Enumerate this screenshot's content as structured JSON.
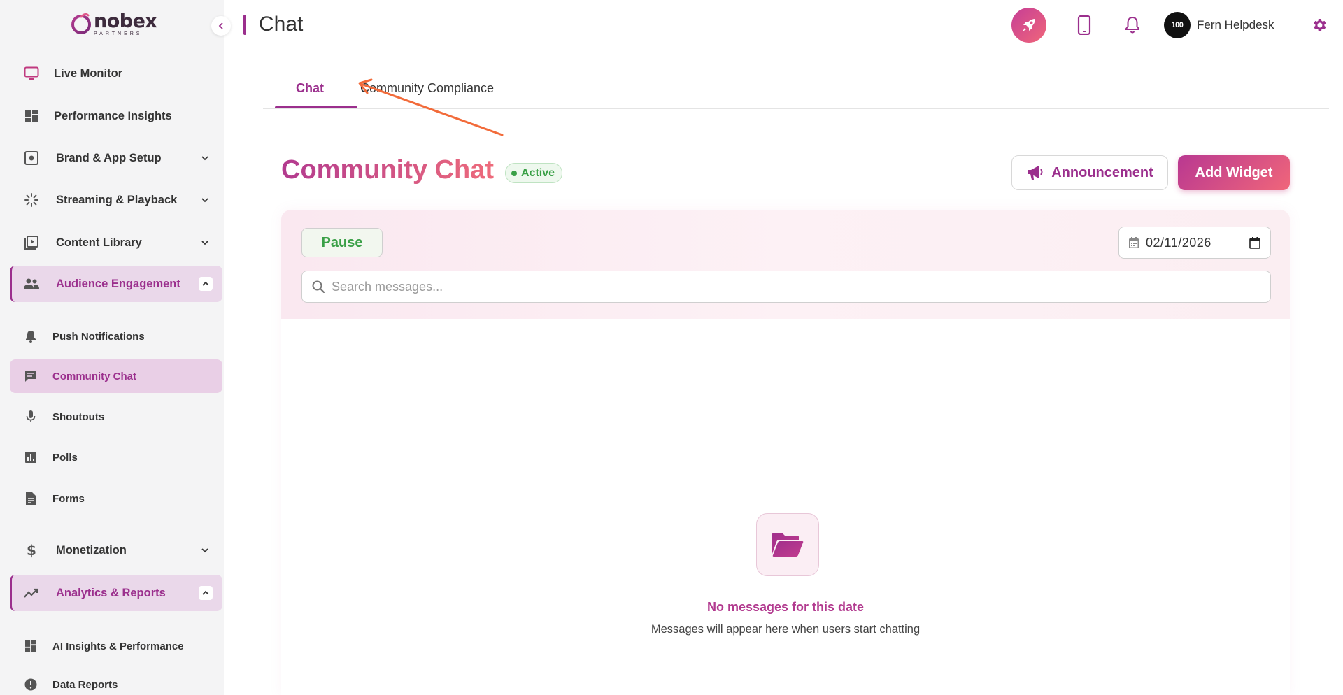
{
  "brand": {
    "name": "nobex",
    "sub": "PARTNERS"
  },
  "sidebar": {
    "items": [
      {
        "label": "Live Monitor"
      },
      {
        "label": "Performance Insights"
      },
      {
        "label": "Brand & App Setup"
      },
      {
        "label": "Streaming & Playback"
      },
      {
        "label": "Content Library"
      },
      {
        "label": "Audience Engagement"
      },
      {
        "label": "Monetization"
      },
      {
        "label": "Analytics & Reports"
      }
    ],
    "engagement_sub": [
      {
        "label": "Push Notifications"
      },
      {
        "label": "Community Chat"
      },
      {
        "label": "Shoutouts"
      },
      {
        "label": "Polls"
      },
      {
        "label": "Forms"
      }
    ],
    "analytics_sub": [
      {
        "label": "AI Insights & Performance"
      },
      {
        "label": "Data Reports"
      }
    ]
  },
  "header": {
    "title": "Chat",
    "user_name": "Fern Helpdesk",
    "avatar_text": "100"
  },
  "tabs": [
    {
      "label": "Chat"
    },
    {
      "label": "Community Compliance"
    }
  ],
  "main": {
    "title": "Community Chat",
    "status": "Active",
    "announcement_label": "Announcement",
    "add_widget_label": "Add Widget",
    "pause_label": "Pause",
    "date_value": "02/11/2026",
    "search_placeholder": "Search messages...",
    "empty_title": "No messages for this date",
    "empty_subtitle": "Messages will appear here when users start chatting"
  },
  "colors": {
    "accent": "#9b2f8d",
    "gradient_start": "#b23a8f",
    "gradient_end": "#ee6b7b",
    "success": "#3aa047",
    "annotation_arrow": "#f26b3a"
  },
  "icons": {
    "live_monitor": "monitor-icon",
    "performance": "dashboard-icon",
    "brand": "settings-box-icon",
    "streaming": "spinner-icon",
    "content": "video-library-icon",
    "audience": "people-icon",
    "push": "bell-icon",
    "community_chat": "chat-icon",
    "shoutouts": "microphone-icon",
    "polls": "bar-chart-icon",
    "forms": "document-icon",
    "monetization": "dollar-icon",
    "analytics": "trend-icon",
    "ai_insights": "dashboard-icon",
    "data_reports": "info-icon",
    "header_rocket": "rocket-icon",
    "header_phone": "phone-icon",
    "header_bell": "bell-icon",
    "header_settings": "gear-icon",
    "announcement": "megaphone-icon",
    "empty": "folder-open-icon"
  }
}
